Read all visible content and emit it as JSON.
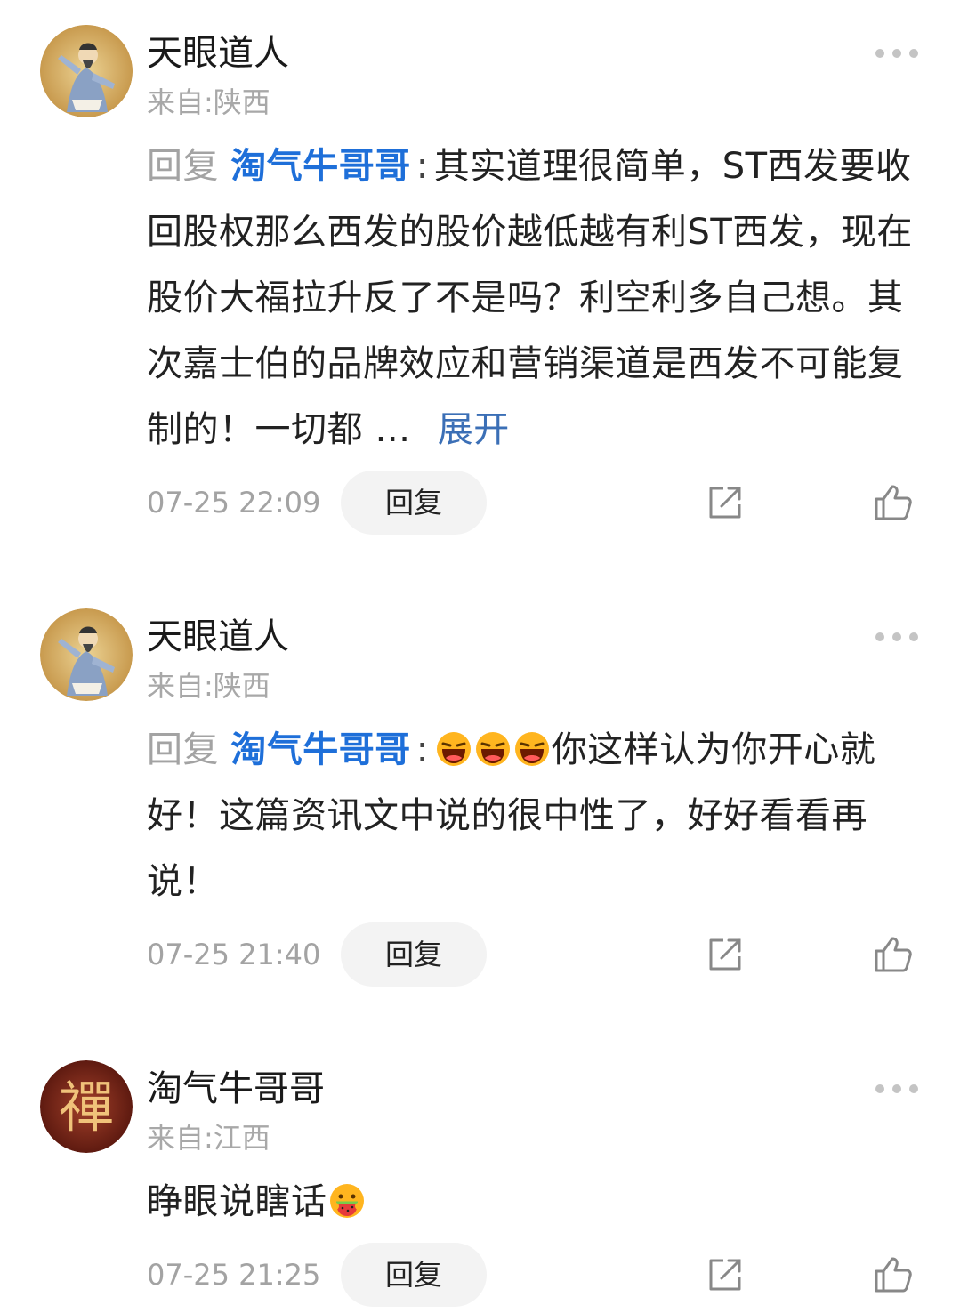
{
  "comments": [
    {
      "username": "天眼道人",
      "location": "来自:陕西",
      "reply_prefix": "回复",
      "mention": "淘气牛哥哥",
      "colon": ":",
      "text": "其实道理很简单，ST西发要收回股权那么西发的股价越低越有利ST西发，现在股价大福拉升反了不是吗？利空利多自己想。其次嘉士伯的品牌效应和营销渠道是西发不可能复制的！一切都 …",
      "expand_label": "展开",
      "time": "07-25 22:09",
      "reply_label": "回复",
      "avatar_icon": "taoist-figure-avatar"
    },
    {
      "username": "天眼道人",
      "location": "来自:陕西",
      "reply_prefix": "回复",
      "mention": "淘气牛哥哥",
      "colon": ":",
      "emoji_count": 3,
      "emoji_icon": "laughing-emoji",
      "text": "你这样认为你开心就好！这篇资讯文中说的很中性了，好好看看再说！",
      "time": "07-25 21:40",
      "reply_label": "回复",
      "avatar_icon": "taoist-figure-avatar"
    },
    {
      "username": "淘气牛哥哥",
      "location": "来自:江西",
      "text": "睁眼说瞎话",
      "emoji_icon": "watermelon-face-emoji",
      "time": "07-25 21:25",
      "reply_label": "回复",
      "avatar_icon": "zen-calligraphy-avatar",
      "avatar_char": "禪"
    }
  ],
  "colors": {
    "mention": "#1e6fd9",
    "expand": "#3b6fb6",
    "secondary_text": "#a3a3a3",
    "reply_button_bg": "#f3f3f3"
  },
  "icons": {
    "more": "more-dots-icon",
    "share": "share-icon",
    "like": "thumbs-up-icon"
  }
}
